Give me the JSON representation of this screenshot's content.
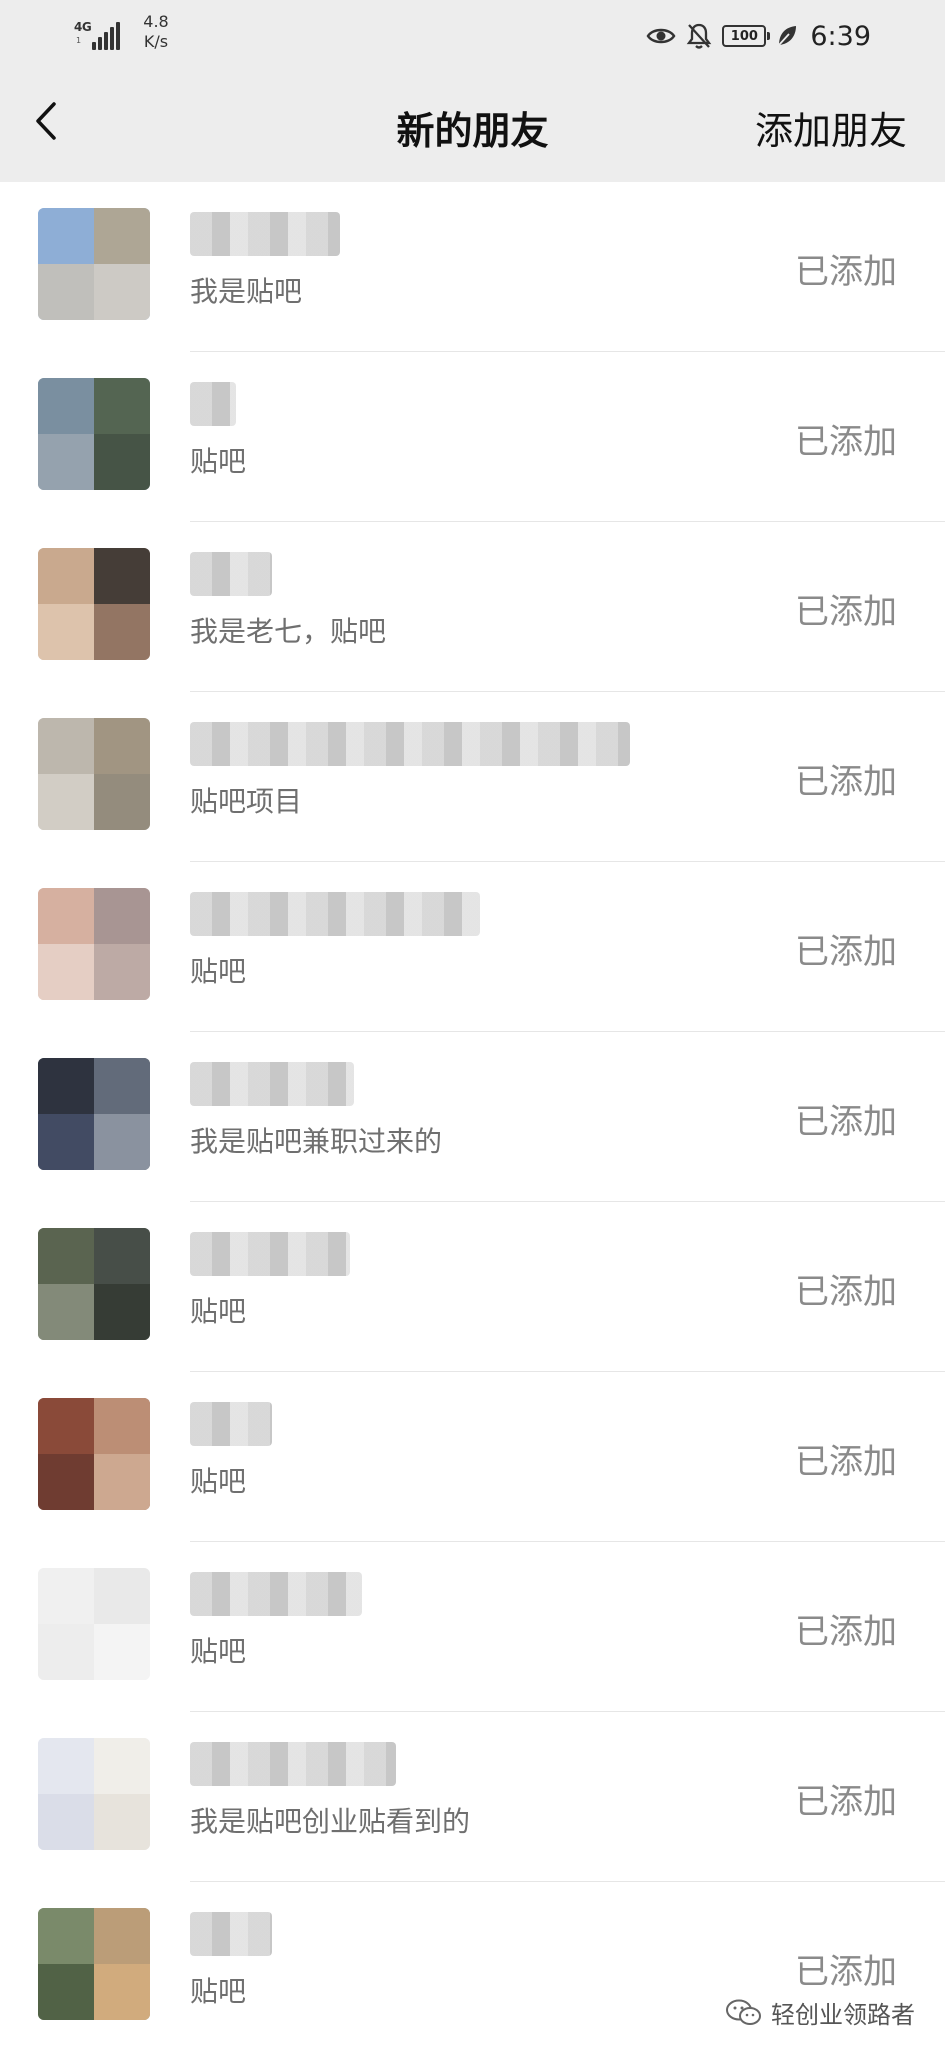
{
  "status_bar": {
    "network": "4G",
    "network_sub": "1",
    "speed_value": "4.8",
    "speed_unit": "K/s",
    "battery": "100",
    "time": "6:39",
    "icons": [
      "eye-icon",
      "bell-off-icon",
      "battery-icon",
      "leaf-icon"
    ]
  },
  "nav": {
    "title": "新的朋友",
    "action": "添加朋友",
    "back_icon": "chevron-left-icon"
  },
  "friends": [
    {
      "message": "我是贴吧",
      "status": "已添加"
    },
    {
      "message": "贴吧",
      "status": "已添加"
    },
    {
      "message": "我是老七，贴吧",
      "status": "已添加"
    },
    {
      "message": "贴吧项目",
      "status": "已添加"
    },
    {
      "message": "贴吧",
      "status": "已添加"
    },
    {
      "message": "我是贴吧兼职过来的",
      "status": "已添加"
    },
    {
      "message": "贴吧",
      "status": "已添加"
    },
    {
      "message": "贴吧",
      "status": "已添加"
    },
    {
      "message": "贴吧",
      "status": "已添加"
    },
    {
      "message": "我是贴吧创业贴看到的",
      "status": "已添加"
    },
    {
      "message": "贴吧",
      "status": "已添加"
    }
  ],
  "watermark": {
    "text": "轻创业领路者",
    "icon": "wechat-icon"
  },
  "colors": {
    "header_bg": "#ededed",
    "text_primary": "#111111",
    "text_secondary": "#6f6f6f",
    "status_text": "#8a8a8a"
  }
}
